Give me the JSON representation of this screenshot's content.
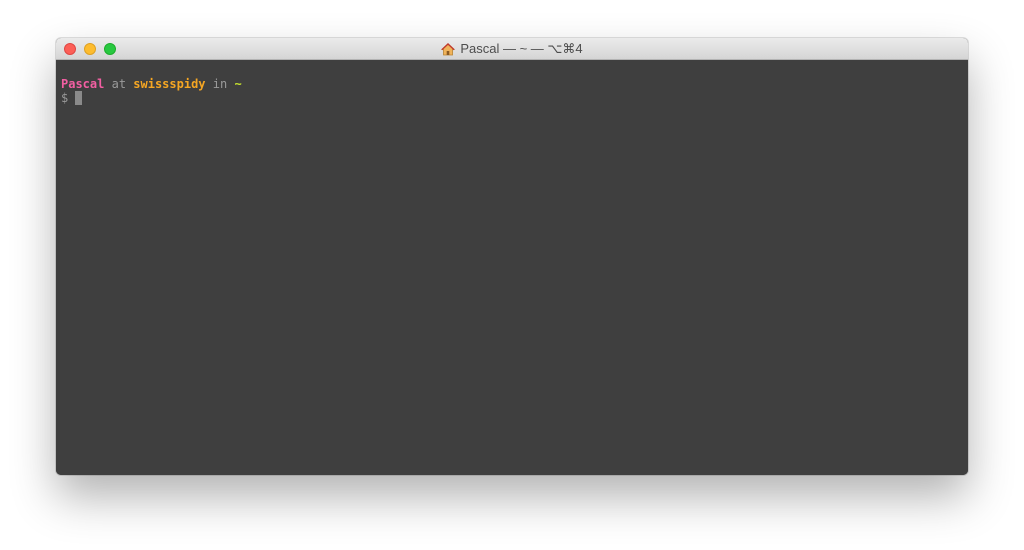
{
  "window": {
    "title": "Pascal — ~ — ⌥⌘4",
    "title_icon": "home-icon",
    "traffic_lights": {
      "close_color": "#fc5f57",
      "minimize_color": "#fdbc2e",
      "zoom_color": "#28c840"
    }
  },
  "terminal": {
    "background": "#3f3f3f",
    "prompt_line": {
      "user": "Pascal",
      "at": "at",
      "host": "swissspidy",
      "in": "in",
      "dir": "~"
    },
    "input_line": {
      "prompt_symbol": "$",
      "value": ""
    },
    "colors": {
      "user": "#f25fa2",
      "host": "#f5a623",
      "dir": "#c6e22e"
    }
  }
}
